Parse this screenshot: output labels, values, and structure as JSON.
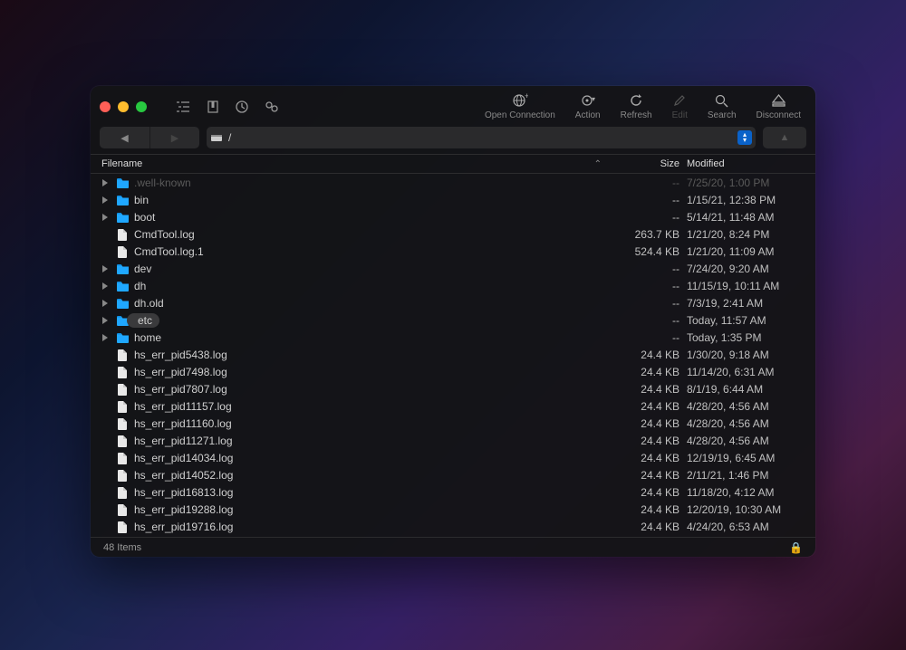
{
  "titlebar": {
    "actions": {
      "open_connection": "Open Connection",
      "action": "Action",
      "refresh": "Refresh",
      "edit": "Edit",
      "search": "Search",
      "disconnect": "Disconnect"
    }
  },
  "path": "/",
  "columns": {
    "filename": "Filename",
    "size": "Size",
    "modified": "Modified"
  },
  "items": [
    {
      "name": ".well-known",
      "type": "folder",
      "expandable": true,
      "size": "--",
      "modified": "7/25/20, 1:00 PM",
      "dim": true
    },
    {
      "name": "bin",
      "type": "folder",
      "expandable": true,
      "size": "--",
      "modified": "1/15/21, 12:38 PM"
    },
    {
      "name": "boot",
      "type": "folder",
      "expandable": true,
      "size": "--",
      "modified": "5/14/21, 11:48 AM"
    },
    {
      "name": "CmdTool.log",
      "type": "file",
      "expandable": false,
      "size": "263.7 KB",
      "modified": "1/21/20, 8:24 PM"
    },
    {
      "name": "CmdTool.log.1",
      "type": "file",
      "expandable": false,
      "size": "524.4 KB",
      "modified": "1/21/20, 11:09 AM"
    },
    {
      "name": "dev",
      "type": "folder",
      "expandable": true,
      "size": "--",
      "modified": "7/24/20, 9:20 AM"
    },
    {
      "name": "dh",
      "type": "folder",
      "expandable": true,
      "size": "--",
      "modified": "11/15/19, 10:11 AM"
    },
    {
      "name": "dh.old",
      "type": "folder",
      "expandable": true,
      "size": "--",
      "modified": "7/3/19, 2:41 AM"
    },
    {
      "name": "etc",
      "type": "folder",
      "expandable": true,
      "size": "--",
      "modified": "Today, 11:57 AM",
      "selected": true
    },
    {
      "name": "home",
      "type": "folder",
      "expandable": true,
      "size": "--",
      "modified": "Today, 1:35 PM"
    },
    {
      "name": "hs_err_pid5438.log",
      "type": "file",
      "expandable": false,
      "size": "24.4 KB",
      "modified": "1/30/20, 9:18 AM"
    },
    {
      "name": "hs_err_pid7498.log",
      "type": "file",
      "expandable": false,
      "size": "24.4 KB",
      "modified": "11/14/20, 6:31 AM"
    },
    {
      "name": "hs_err_pid7807.log",
      "type": "file",
      "expandable": false,
      "size": "24.4 KB",
      "modified": "8/1/19, 6:44 AM"
    },
    {
      "name": "hs_err_pid11157.log",
      "type": "file",
      "expandable": false,
      "size": "24.4 KB",
      "modified": "4/28/20, 4:56 AM"
    },
    {
      "name": "hs_err_pid11160.log",
      "type": "file",
      "expandable": false,
      "size": "24.4 KB",
      "modified": "4/28/20, 4:56 AM"
    },
    {
      "name": "hs_err_pid11271.log",
      "type": "file",
      "expandable": false,
      "size": "24.4 KB",
      "modified": "4/28/20, 4:56 AM"
    },
    {
      "name": "hs_err_pid14034.log",
      "type": "file",
      "expandable": false,
      "size": "24.4 KB",
      "modified": "12/19/19, 6:45 AM"
    },
    {
      "name": "hs_err_pid14052.log",
      "type": "file",
      "expandable": false,
      "size": "24.4 KB",
      "modified": "2/11/21, 1:46 PM"
    },
    {
      "name": "hs_err_pid16813.log",
      "type": "file",
      "expandable": false,
      "size": "24.4 KB",
      "modified": "11/18/20, 4:12 AM"
    },
    {
      "name": "hs_err_pid19288.log",
      "type": "file",
      "expandable": false,
      "size": "24.4 KB",
      "modified": "12/20/19, 10:30 AM"
    },
    {
      "name": "hs_err_pid19716.log",
      "type": "file",
      "expandable": false,
      "size": "24.4 KB",
      "modified": "4/24/20, 6:53 AM"
    }
  ],
  "status": "48 Items"
}
